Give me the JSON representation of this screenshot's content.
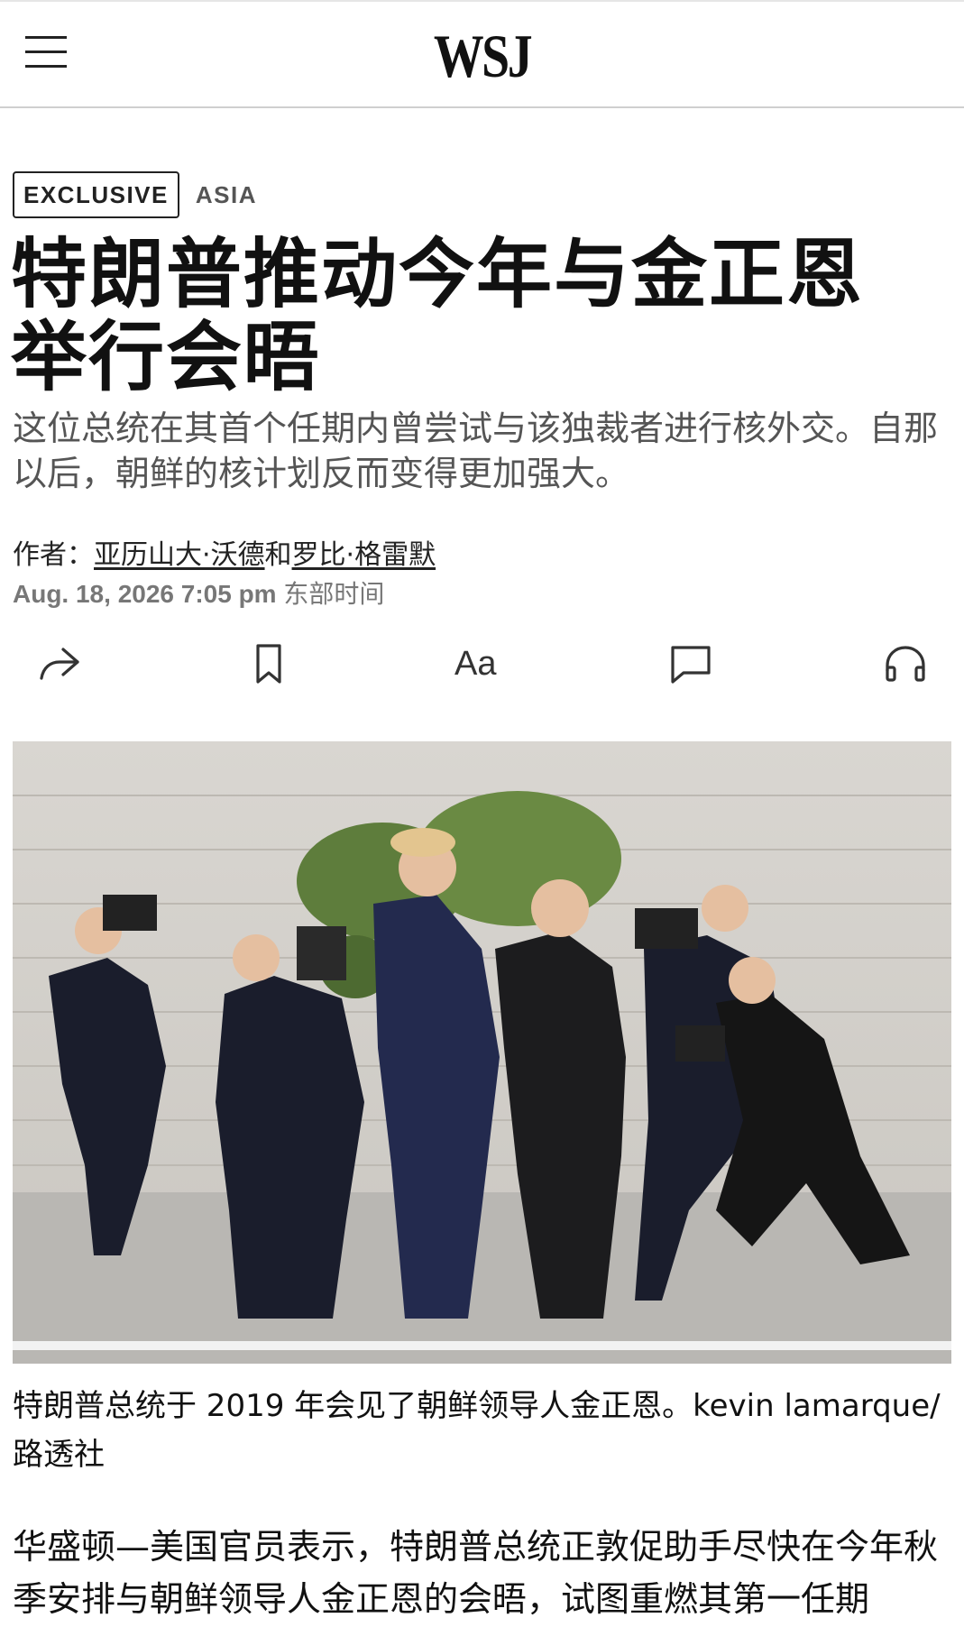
{
  "header": {
    "logo": "WSJ"
  },
  "article": {
    "tag_exclusive": "EXCLUSIVE",
    "tag_section": "ASIA",
    "headline_line1": "特朗普推动今年与金正恩",
    "headline_line2": "举行会晤",
    "dek": "这位总统在其首个任期内曾尝试与该独裁者进行核外交。自那以后，朝鲜的核计划反而变得更加强大。",
    "byline_prefix": "作者：",
    "author1": "亚历山大·沃德",
    "byline_joiner": "和",
    "author2": "罗比·格雷默",
    "date": "Aug. 18, 2026 7:05 pm",
    "timezone": "东部时间",
    "caption": "特朗普总统于 2019 年会见了朝鲜领导人金正恩。kevin lamarque/路透社",
    "body": "华盛顿—美国官员表示，特朗普总统正敦促助手尽快在今年秋季安排与朝鲜领导人金正恩的会晤，试图重燃其第一任期"
  },
  "toolbar": {
    "share_icon": "share-icon",
    "bookmark_icon": "bookmark-icon",
    "text_size_label": "Aa",
    "comments_icon": "comment-icon",
    "listen_icon": "headphones-icon"
  },
  "colors": {
    "text": "#111111",
    "dek": "#555555",
    "date": "#777777"
  }
}
